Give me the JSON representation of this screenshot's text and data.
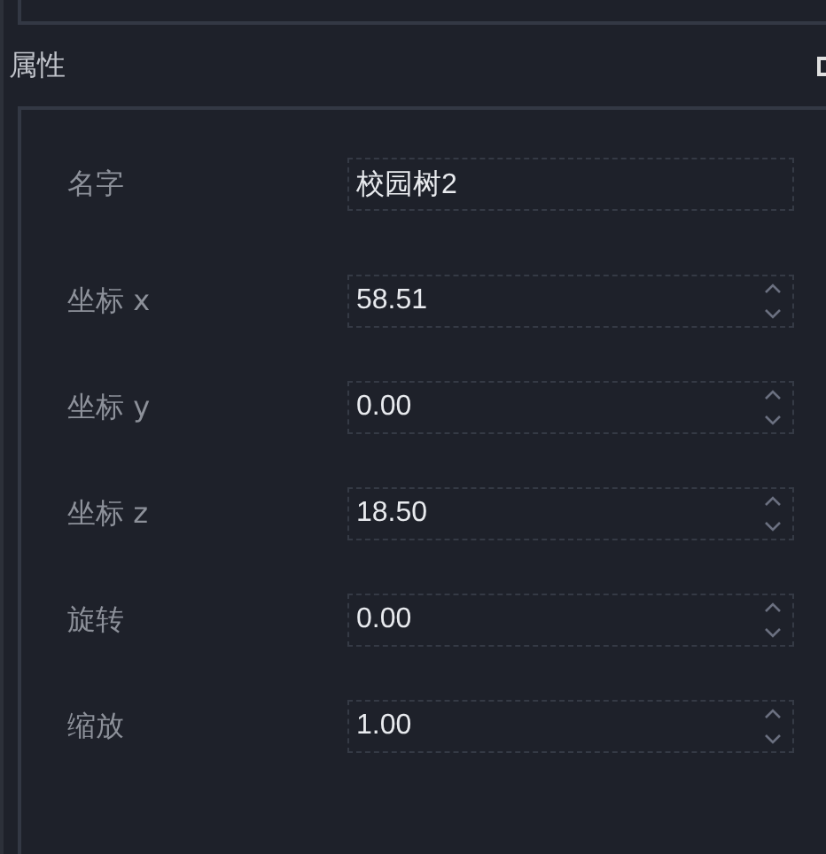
{
  "panel": {
    "title": "属性"
  },
  "fields": [
    {
      "label": "名字",
      "kind": "text",
      "value": "校园树2"
    },
    {
      "label": "坐标 x",
      "kind": "spin",
      "value": "58.51"
    },
    {
      "label": "坐标 y",
      "kind": "spin",
      "value": "0.00"
    },
    {
      "label": "坐标 z",
      "kind": "spin",
      "value": "18.50"
    },
    {
      "label": "旋转",
      "kind": "spin",
      "value": "0.00"
    },
    {
      "label": "缩放",
      "kind": "spin",
      "value": "1.00"
    }
  ]
}
